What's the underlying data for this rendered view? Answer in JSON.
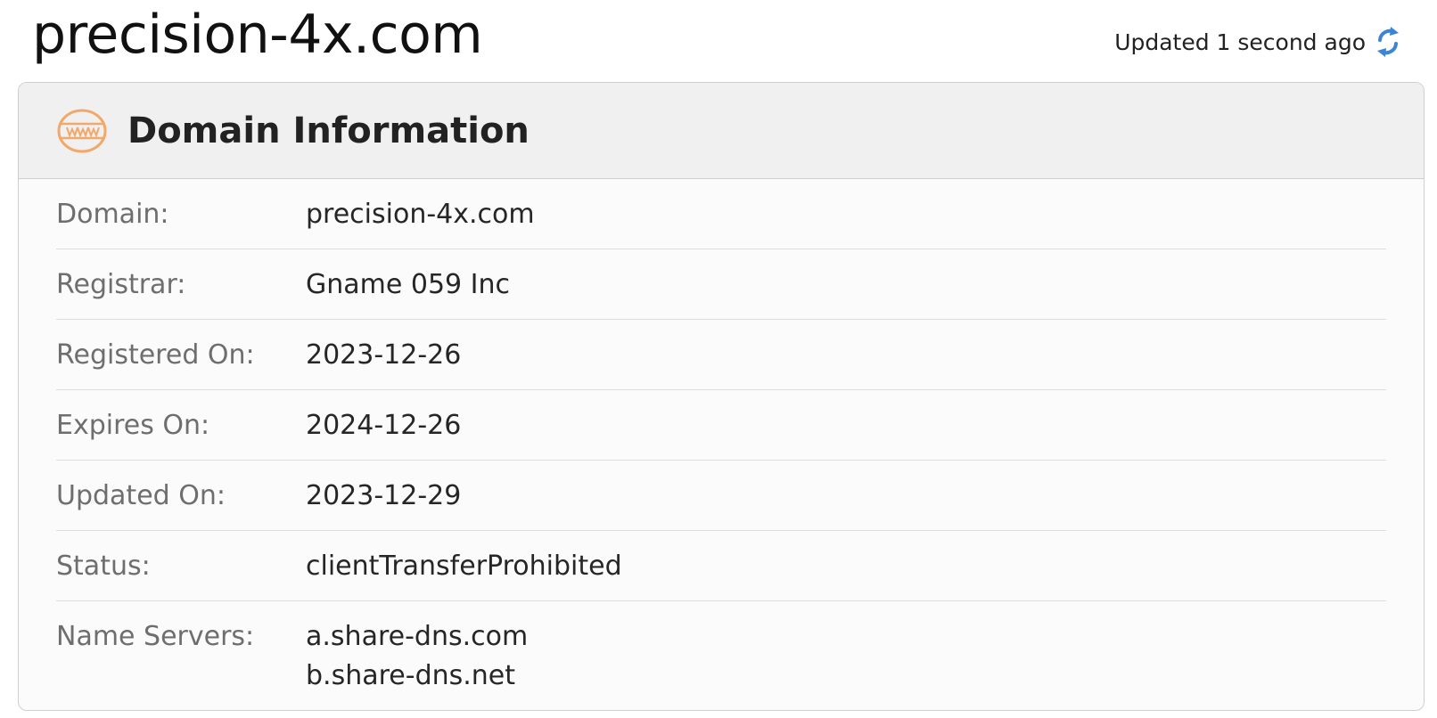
{
  "header": {
    "domain_title": "precision-4x.com",
    "updated_text": "Updated 1 second ago"
  },
  "card": {
    "title": "Domain Information",
    "icon": "www-icon",
    "rows": [
      {
        "label": "Domain:",
        "value": "precision-4x.com"
      },
      {
        "label": "Registrar:",
        "value": "Gname 059 Inc"
      },
      {
        "label": "Registered On:",
        "value": "2023-12-26"
      },
      {
        "label": "Expires On:",
        "value": "2024-12-26"
      },
      {
        "label": "Updated On:",
        "value": "2023-12-29"
      },
      {
        "label": "Status:",
        "value": "clientTransferProhibited"
      }
    ],
    "name_servers": {
      "label": "Name Servers:",
      "values": [
        "a.share-dns.com",
        "b.share-dns.net"
      ]
    }
  },
  "colors": {
    "accent_icon": "#f0a060",
    "refresh_icon": "#3a86d4",
    "header_bg": "#f0f0f0"
  }
}
